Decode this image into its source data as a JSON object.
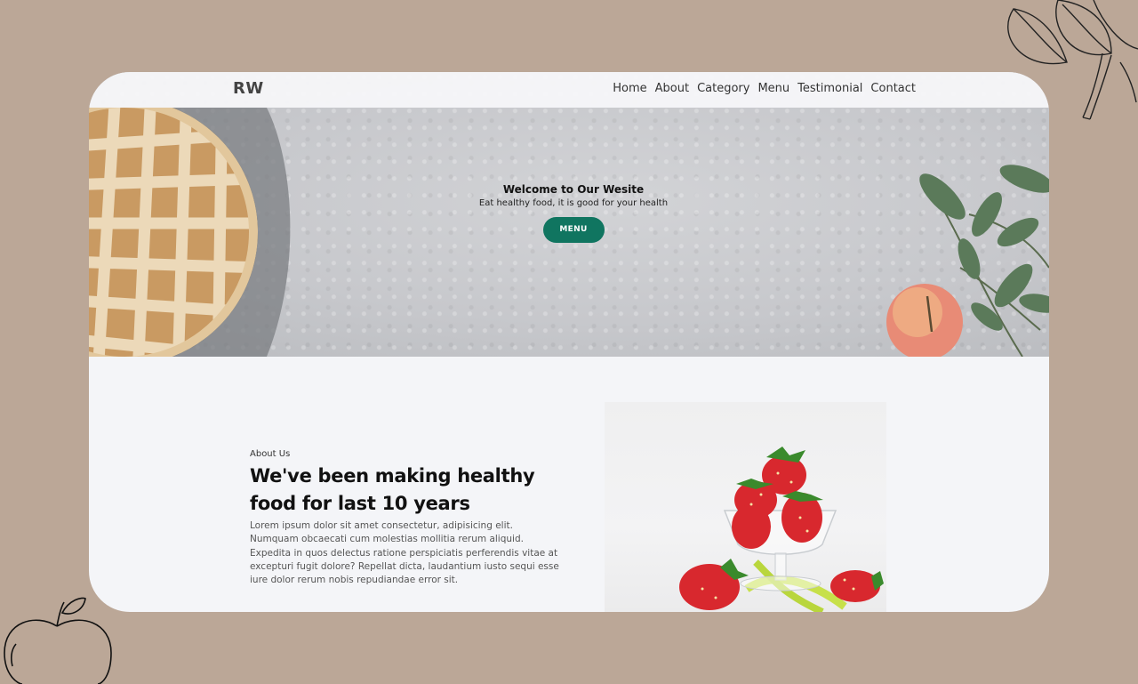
{
  "nav": {
    "logo": "RW",
    "links": [
      "Home",
      "About",
      "Category",
      "Menu",
      "Testimonial",
      "Contact"
    ]
  },
  "hero": {
    "title": "Welcome to Our Wesite",
    "subtitle": "Eat healthy food, it is good for your health",
    "button": "MENU"
  },
  "about": {
    "label": "About Us",
    "heading": "We've been making healthy food for last 10 years",
    "body": "Lorem ipsum dolor sit amet consectetur, adipisicing elit. Numquam obcaecati cum molestias mollitia rerum aliquid. Expedita in quos delectus ratione perspiciatis perferendis vitae at excepturi fugit dolore? Repellat dicta, laudantium iusto sequi esse iure dolor rerum nobis repudiandae error sit."
  },
  "colors": {
    "page_background": "#bba797",
    "accent": "#107560"
  }
}
